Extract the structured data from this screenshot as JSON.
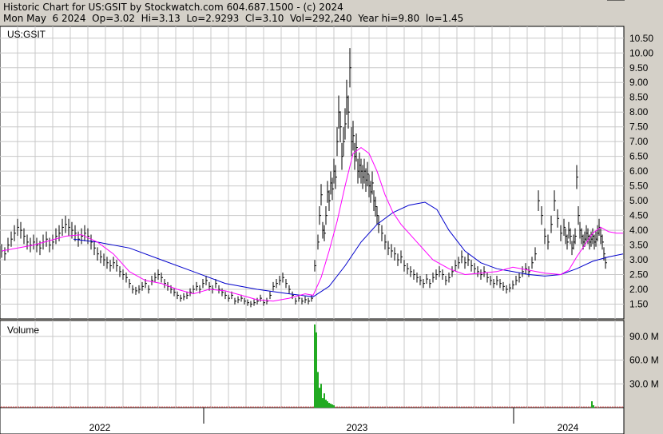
{
  "header": {
    "line1": "Historic Chart for US:GSIT by Stockwatch.com 604.687.1500 - (c) 2024",
    "line2": "Mon May  6 2024  Op=3.02  Hi=3.13  Lo=2.9293  Cl=3.10  Vol=292,240  Year hi=9.80  lo=1.45"
  },
  "chart_data": [
    {
      "type": "line",
      "title": "US:GSIT",
      "y_axis": {
        "ticks": [
          1.5,
          2.0,
          2.5,
          3.0,
          3.5,
          4.0,
          4.5,
          5.0,
          5.5,
          6.0,
          6.5,
          7.0,
          7.5,
          8.0,
          8.5,
          9.0,
          9.5,
          10.0,
          10.5
        ],
        "tick_labels": [
          "1.50",
          "2.00",
          "2.50",
          "3.00",
          "3.50",
          "4.00",
          "4.50",
          "5.00",
          "5.50",
          "6.00",
          "6.50",
          "7.00",
          "7.50",
          "8.00",
          "8.50",
          "9.00",
          "9.50",
          "10.00",
          "10.50"
        ],
        "ylim": [
          1.0,
          10.9
        ]
      },
      "x_axis": {
        "labels": [
          "2022",
          "2023",
          "2024"
        ]
      },
      "price_series": {
        "x": [
          0,
          4,
          8,
          12,
          16,
          20,
          24,
          28,
          32,
          36,
          40,
          44,
          48,
          52,
          56,
          60,
          64,
          68,
          72,
          76,
          80,
          84,
          88,
          92,
          96,
          100,
          104,
          108,
          112,
          116,
          120,
          124,
          128,
          132,
          136,
          140,
          144,
          148,
          152,
          156,
          160,
          164,
          168,
          172,
          176,
          180,
          184,
          188,
          192,
          196,
          200,
          204,
          208,
          212,
          216,
          220,
          224,
          228,
          232,
          236,
          240,
          244,
          248,
          252,
          256,
          260,
          264,
          268,
          272,
          276,
          280,
          284,
          288,
          292,
          296,
          300,
          304,
          308,
          312,
          316,
          320,
          324,
          328,
          332,
          336,
          340,
          344,
          348,
          352,
          356,
          360,
          364,
          368,
          372,
          376,
          380,
          384,
          388,
          392,
          396,
          398,
          400,
          402,
          404,
          406,
          408,
          410,
          412,
          414,
          416,
          418,
          420,
          422,
          424,
          426,
          428,
          430,
          432,
          434,
          436,
          438,
          440,
          442,
          444,
          446,
          448,
          450,
          452,
          454,
          456,
          458,
          460,
          462,
          464,
          466,
          468,
          470,
          472,
          476,
          480,
          484,
          488,
          492,
          496,
          500,
          504,
          508,
          512,
          516,
          520,
          524,
          528,
          532,
          536,
          540,
          544,
          548,
          552,
          556,
          560,
          564,
          568,
          572,
          576,
          580,
          584,
          588,
          592,
          596,
          600,
          604,
          608,
          612,
          616,
          620,
          624,
          628,
          632,
          636,
          640,
          644,
          648,
          652,
          656,
          660,
          664,
          668,
          672,
          676,
          680,
          684,
          688,
          692,
          696,
          700,
          704,
          706,
          708,
          710,
          712,
          714,
          716,
          718,
          720,
          722,
          724,
          726,
          728,
          730,
          732,
          734,
          736,
          738,
          740,
          742,
          744,
          746,
          748,
          750,
          752,
          754,
          756,
          758,
          760,
          762,
          764,
          766,
          768,
          770,
          772,
          774,
          776,
          778
        ],
        "close": [
          3.3,
          3.2,
          3.5,
          3.7,
          3.9,
          4.1,
          4.0,
          3.8,
          3.6,
          3.5,
          3.6,
          3.5,
          3.4,
          3.6,
          3.7,
          3.5,
          3.6,
          3.8,
          3.9,
          4.1,
          4.2,
          4.1,
          4.0,
          3.9,
          3.7,
          3.8,
          3.9,
          3.8,
          3.6,
          3.4,
          3.2,
          3.1,
          3.0,
          2.9,
          2.8,
          2.9,
          2.8,
          2.6,
          2.5,
          2.4,
          2.2,
          2.0,
          1.95,
          2.0,
          2.1,
          2.2,
          2.0,
          2.3,
          2.4,
          2.5,
          2.4,
          2.2,
          2.1,
          2.0,
          1.9,
          1.8,
          1.7,
          1.75,
          1.8,
          1.9,
          2.0,
          2.1,
          2.0,
          2.2,
          2.3,
          2.1,
          2.0,
          2.2,
          2.0,
          1.9,
          1.8,
          1.7,
          1.8,
          1.6,
          1.65,
          1.7,
          1.6,
          1.55,
          1.5,
          1.55,
          1.6,
          1.7,
          1.55,
          1.6,
          1.8,
          2.1,
          2.2,
          2.3,
          2.4,
          2.2,
          2.0,
          1.8,
          1.6,
          1.7,
          1.6,
          1.65,
          1.6,
          1.7,
          2.8,
          3.6,
          4.5,
          5.2,
          4.0,
          3.9,
          4.5,
          5.3,
          5.0,
          5.6,
          5.4,
          6.0,
          5.8,
          7.0,
          8.0,
          7.5,
          6.5,
          7.0,
          7.6,
          8.5,
          8.0,
          9.5,
          7.0,
          7.2,
          6.5,
          6.8,
          6.0,
          6.2,
          6.0,
          5.8,
          6.0,
          5.7,
          5.9,
          5.5,
          5.3,
          5.6,
          5.0,
          4.8,
          4.5,
          4.2,
          3.9,
          3.6,
          3.4,
          3.3,
          3.2,
          3.0,
          3.1,
          2.8,
          2.7,
          2.6,
          2.5,
          2.4,
          2.3,
          2.2,
          2.35,
          2.2,
          2.4,
          2.5,
          2.6,
          2.5,
          2.3,
          2.4,
          2.6,
          2.8,
          2.9,
          3.1,
          2.9,
          3.0,
          2.8,
          2.7,
          2.6,
          2.5,
          2.6,
          2.4,
          2.3,
          2.2,
          2.3,
          2.2,
          2.1,
          2.0,
          2.05,
          2.15,
          2.3,
          2.4,
          2.6,
          2.7,
          2.6,
          2.9,
          3.2,
          5.0,
          4.5,
          3.8,
          3.6,
          4.2,
          5.0,
          4.4,
          3.9,
          4.1,
          3.8,
          3.6,
          4.0,
          3.8,
          3.4,
          3.6,
          3.8,
          5.8,
          4.5,
          4.0,
          3.8,
          3.6,
          3.7,
          3.9,
          3.8,
          3.6,
          3.7,
          3.8,
          3.6,
          3.7,
          3.9,
          4.1,
          3.8,
          3.6,
          3.2,
          2.9
        ]
      },
      "ma_short": {
        "name": "",
        "color": "#ff00ff",
        "x": [
          0,
          40,
          80,
          100,
          120,
          140,
          160,
          180,
          200,
          220,
          240,
          260,
          280,
          300,
          320,
          340,
          360,
          380,
          390,
          400,
          410,
          420,
          430,
          440,
          450,
          460,
          470,
          480,
          490,
          500,
          520,
          540,
          560,
          580,
          600,
          620,
          640,
          660,
          680,
          700,
          710,
          720,
          730,
          740,
          750,
          760,
          770,
          778
        ],
        "values": [
          3.3,
          3.5,
          3.8,
          3.85,
          3.6,
          3.2,
          2.6,
          2.3,
          2.2,
          2.0,
          1.85,
          2.0,
          1.95,
          1.8,
          1.65,
          1.6,
          1.7,
          1.85,
          1.8,
          2.4,
          3.3,
          4.3,
          5.5,
          6.6,
          6.8,
          6.6,
          6.0,
          5.2,
          4.6,
          4.2,
          3.6,
          3.0,
          2.7,
          2.5,
          2.55,
          2.6,
          2.75,
          2.65,
          2.55,
          2.5,
          2.65,
          3.1,
          3.5,
          3.9,
          4.1,
          3.95,
          3.9,
          3.9
        ]
      },
      "ma_long": {
        "name": "",
        "color": "#0000cc",
        "x": [
          90,
          120,
          160,
          200,
          240,
          280,
          320,
          360,
          390,
          410,
          430,
          450,
          470,
          490,
          510,
          530,
          545,
          560,
          580,
          600,
          620,
          640,
          660,
          680,
          700,
          720,
          740,
          760,
          778
        ],
        "values": [
          3.7,
          3.6,
          3.4,
          3.0,
          2.6,
          2.2,
          2.0,
          1.85,
          1.75,
          2.1,
          2.8,
          3.6,
          4.2,
          4.6,
          4.85,
          4.95,
          4.7,
          4.0,
          3.3,
          2.9,
          2.7,
          2.6,
          2.5,
          2.45,
          2.5,
          2.7,
          2.95,
          3.1,
          3.2
        ]
      }
    },
    {
      "type": "bar",
      "title": "Volume",
      "y_axis": {
        "ticks": [
          30,
          60,
          90
        ],
        "tick_labels": [
          "30.0 M",
          "60.0 M",
          "90.0 M"
        ],
        "ylim": [
          0,
          110
        ]
      },
      "spikes": {
        "x": [
          393,
          395,
          397,
          399,
          401,
          403,
          405,
          407,
          409,
          411,
          413,
          415,
          417,
          740,
          742
        ],
        "values": [
          105,
          95,
          45,
          25,
          30,
          12,
          18,
          10,
          8,
          6,
          5,
          4,
          3,
          8,
          3
        ]
      },
      "baseline": {
        "value": 1.5
      }
    }
  ]
}
